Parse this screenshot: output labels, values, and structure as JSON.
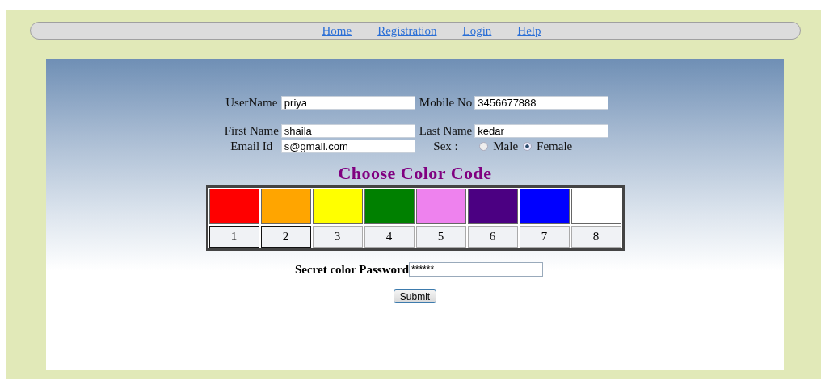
{
  "nav": [
    {
      "label": "Home"
    },
    {
      "label": "Registration"
    },
    {
      "label": "Login"
    },
    {
      "label": "Help"
    }
  ],
  "fields": [
    {
      "label": "UserName",
      "value": "priya"
    },
    {
      "label": "Mobile No",
      "value": "3456677888"
    },
    {
      "label": "First Name",
      "value": "shaila"
    },
    {
      "label": "Last Name",
      "value": "kedar"
    },
    {
      "label": "Email Id",
      "value": "s@gmail.com"
    }
  ],
  "sex": {
    "label": "Sex :",
    "options": [
      {
        "label": "Male",
        "selected": false
      },
      {
        "label": "Female",
        "selected": true
      }
    ]
  },
  "color_title": "Choose Color Code",
  "colors": [
    {
      "color": "#ff0000",
      "number": "1",
      "selected": true
    },
    {
      "color": "#ffa500",
      "number": "2",
      "selected": true
    },
    {
      "color": "#ffff00",
      "number": "3",
      "selected": false
    },
    {
      "color": "#008000",
      "number": "4",
      "selected": false
    },
    {
      "color": "#ee82ee",
      "number": "5",
      "selected": false
    },
    {
      "color": "#4b0082",
      "number": "6",
      "selected": false
    },
    {
      "color": "#0000ff",
      "number": "7",
      "selected": false
    },
    {
      "color": "#ffffff",
      "number": "8",
      "selected": false
    }
  ],
  "password": {
    "label": "Secret color Password",
    "value": "******"
  },
  "submit": "Submit"
}
